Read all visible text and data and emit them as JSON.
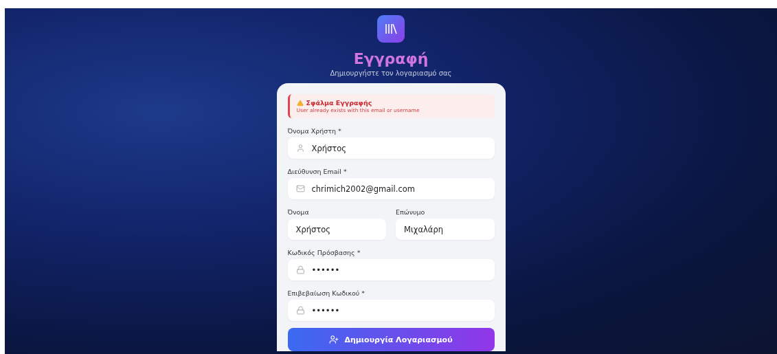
{
  "header": {
    "title": "Εγγραφή",
    "subtitle": "Δημιουργήστε τον λογαριασμό σας"
  },
  "error": {
    "title": "Σφάλμα Εγγραφής",
    "message": "User already exists with this email or username"
  },
  "rows": [
    {
      "fields": [
        {
          "label": "Όνομα Χρήστη *",
          "value": "Χρήστος",
          "kind": "username"
        }
      ]
    },
    {
      "fields": [
        {
          "label": "Διεύθυνση Email *",
          "value": "chrimich2002@gmail.com",
          "kind": "email"
        }
      ]
    },
    {
      "fields": [
        {
          "label": "Όνομα",
          "value": "Χρήστος",
          "kind": "text"
        },
        {
          "label": "Επώνυμο",
          "value": "Μιχαλάρη",
          "kind": "text"
        }
      ]
    },
    {
      "fields": [
        {
          "label": "Κωδικός Πρόσβασης *",
          "value": "••••••",
          "kind": "password"
        }
      ]
    },
    {
      "fields": [
        {
          "label": "Επιβεβαίωση Κωδικού *",
          "value": "••••••",
          "kind": "password"
        }
      ]
    }
  ],
  "submit": {
    "label": "Δημιουργία Λογαριασμού"
  }
}
